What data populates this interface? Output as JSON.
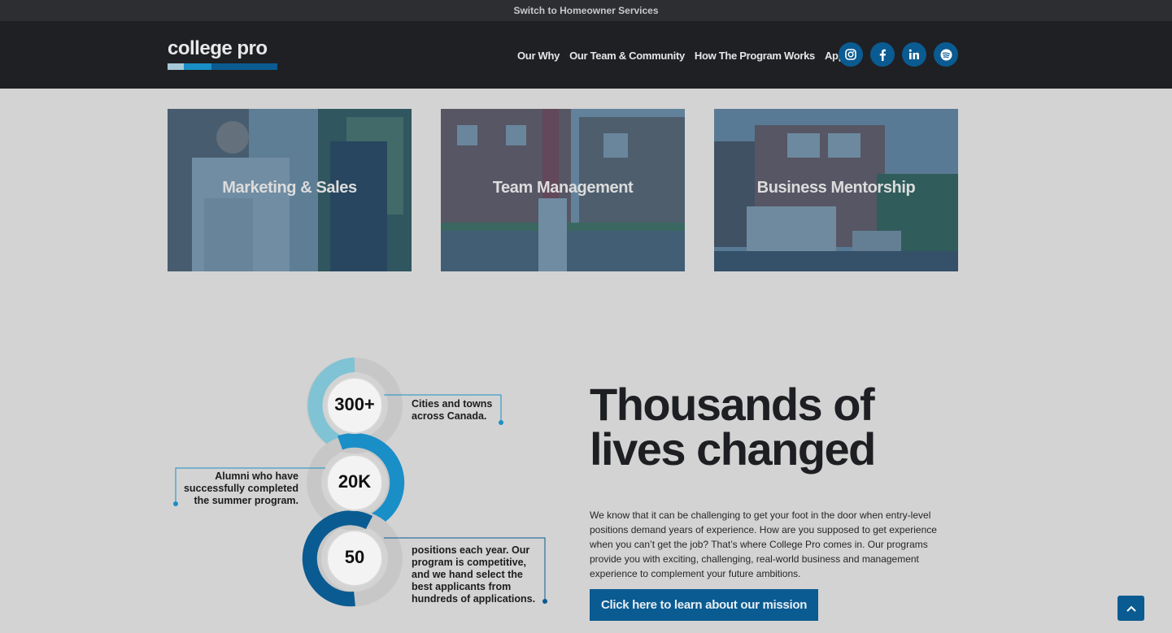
{
  "topbar": {
    "label": "Switch to Homeowner Services"
  },
  "logo": {
    "text": "college pro",
    "bar_colors": [
      "#a7c8d6",
      "#1a8fc7",
      "#0a5b91"
    ]
  },
  "nav": {
    "items": [
      "Our Why",
      "Our Team & Community",
      "How The Program Works",
      "Apply"
    ]
  },
  "social": [
    "instagram-icon",
    "facebook-icon",
    "linkedin-icon",
    "spotify-icon"
  ],
  "cards": [
    {
      "label": "Marketing & Sales"
    },
    {
      "label": "Team Management"
    },
    {
      "label": "Business Mentorship"
    }
  ],
  "stats": [
    {
      "value": "300+",
      "desc": "Cities and towns across Canada."
    },
    {
      "value": "20K",
      "desc": "Alumni who have successfully completed the summer program."
    },
    {
      "value": "50",
      "desc": "positions each year. Our program is competitive, and we hand select the best applicants from hundreds of applications."
    }
  ],
  "main": {
    "headline": "Thousands of lives changed",
    "paragraph": "We know that it can be challenging to get your foot in the door when entry-level positions demand years of experience. How are you supposed to get experience when you can’t get the job? That’s where College Pro comes in. Our programs provide you with exciting, challenging, real-world business and management experience to complement your future ambitions.",
    "cta": "Click here to learn about our mission"
  },
  "colors": {
    "accent": "#0a5b91",
    "light_accent": "#7fc3d4",
    "mid_accent": "#1a8fc7",
    "header_bg": "#1f2024"
  }
}
